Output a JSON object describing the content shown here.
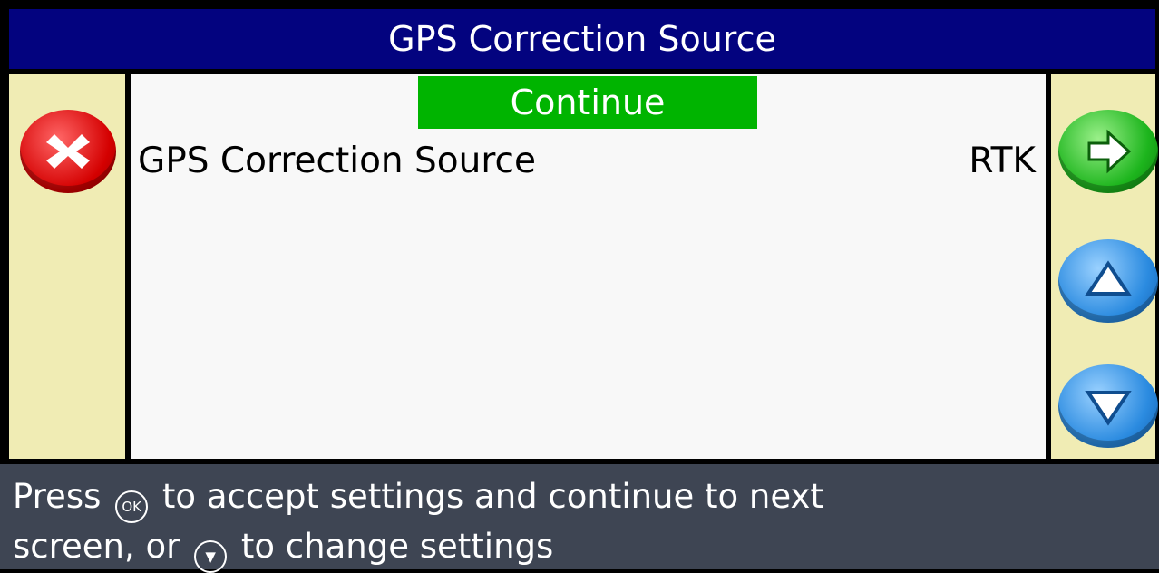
{
  "header": {
    "title": "GPS Correction Source"
  },
  "panel": {
    "continue_label": "Continue",
    "setting": {
      "label": "GPS Correction Source",
      "value": "RTK"
    }
  },
  "footer": {
    "line1_pre": "Press",
    "ok_glyph": "OK",
    "line1_post": "to accept settings and continue to next",
    "line2_pre": "screen, or",
    "line2_post": "to change settings"
  },
  "icons": {
    "cancel": "cancel-x-icon",
    "next": "next-arrow-icon",
    "up": "up-arrow-icon",
    "down": "down-arrow-icon"
  },
  "colors": {
    "title_bar": "#03037f",
    "side_bar": "#f0ecb4",
    "continue": "#00b400",
    "footer": "#3e4553"
  }
}
